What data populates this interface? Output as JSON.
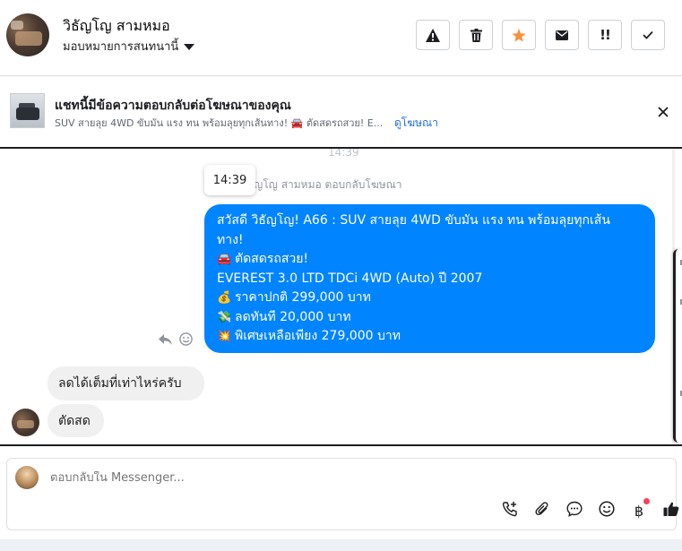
{
  "header": {
    "contact_name": "วิธัญโญ สามหมอ",
    "assignment": "มอบหมายการสนทนานี้",
    "buttons": [
      {
        "name": "report",
        "icon": "warning-icon"
      },
      {
        "name": "delete",
        "icon": "trash-icon"
      },
      {
        "name": "star",
        "icon": "star-icon",
        "color": "#f7923b"
      },
      {
        "name": "mark-unread",
        "icon": "envelope-icon"
      },
      {
        "name": "follow-up",
        "icon": "exclamation-icon",
        "label": "!!"
      },
      {
        "name": "mark-done",
        "icon": "check-icon"
      }
    ]
  },
  "ad_banner": {
    "title": "แชทนี้มีข้อความตอบกลับต่อโฆษณาของคุณ",
    "snippet": "SUV สายลุย 4WD ขับมัน แรง ทน พร้อมลุยทุกเส้นทาง! 🚘 ตัดสดรถสวย! E...",
    "link": "ดูโฆษณา"
  },
  "thread": {
    "ghost_time": "14:39",
    "tooltip_time": "14:39",
    "ad_reply_note": "ญโญ สามหมอ ตอบกลับโฆษณา",
    "outgoing": {
      "color": "#0084ff",
      "line1": "สวัสดี วิธัญโญ! A66 : SUV สายลุย 4WD ขับมัน แรง ทน พร้อมลุยทุกเส้น",
      "line2": "ทาง!",
      "line3_emoji": "🚘",
      "line3": "ตัดสดรถสวย!",
      "line4": "EVEREST 3.0 LTD TDCi 4WD (Auto) ปี 2007",
      "line5_emoji": "💰",
      "line5": "ราคาปกติ 299,000 บาท",
      "line6_emoji": "💸",
      "line6": "ลดทันที 20,000 บาท",
      "line7_emoji": "💥",
      "line7": "พิเศษเหลือเพียง 279,000 บาท"
    },
    "incoming": [
      "ลดได้เต็มที่เท่าไหร่ครับ",
      "ตัดสด"
    ]
  },
  "composer": {
    "placeholder": "ตอบกลับใน Messenger...",
    "icons": [
      "add-call-icon",
      "attachment-icon",
      "saved-replies-icon",
      "emoji-icon",
      "payment-icon",
      "like-icon"
    ],
    "payment_symbol": "฿",
    "notification_color": "#fa3e5f"
  }
}
